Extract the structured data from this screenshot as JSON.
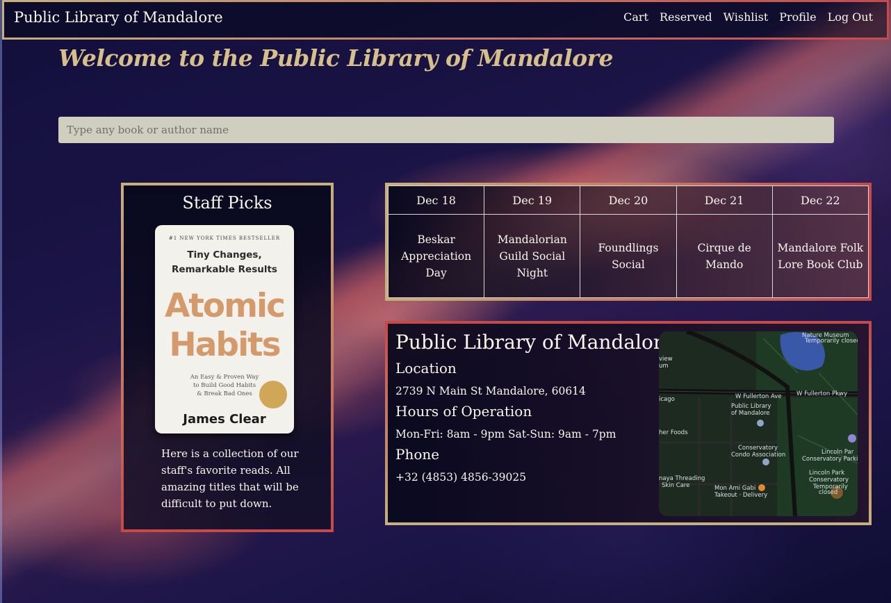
{
  "navbar": {
    "brand": "Public Library of Mandalore",
    "links": [
      "Cart",
      "Reserved",
      "Wishlist",
      "Profile",
      "Log Out"
    ]
  },
  "welcome": "Welcome to the Public Library of Mandalore",
  "search": {
    "placeholder": "Type any book or author name"
  },
  "staff_picks": {
    "title": "Staff Picks",
    "book": {
      "tag": "#1 NEW YORK TIMES BESTSELLER",
      "subtitle_line1": "Tiny Changes,",
      "subtitle_line2": "Remarkable Results",
      "title_line1": "Atomic",
      "title_line2": "Habits",
      "tagline_line1": "An Easy & Proven Way",
      "tagline_line2": "to Build Good Habits",
      "tagline_line3": "& Break Bad Ones",
      "author": "James Clear"
    },
    "description": "Here is a collection of our staff's favorite reads. All amazing titles that will be difficult to put down."
  },
  "events": {
    "dates": [
      "Dec 18",
      "Dec 19",
      "Dec 20",
      "Dec 21",
      "Dec 22"
    ],
    "names": [
      "Beskar Appreciation Day",
      "Mandalorian Guild Social Night",
      "Foundlings Social",
      "Cirque de Mando",
      "Mandalore Folk Lore Book Club"
    ]
  },
  "info": {
    "name": "Public Library of Mandalore",
    "location_heading": "Location",
    "address": "2739 N Main St Mandalore, 60614",
    "hours_heading": "Hours of Operation",
    "hours": "Mon-Fri: 8am - 9pm Sat-Sun: 9am - 7pm",
    "phone_heading": "Phone",
    "phone": "+32 (4853) 4856-39025"
  },
  "map": {
    "labels": {
      "museum": "Nature Museum",
      "museum_status": "Temporarily closed",
      "w_fullerton_ave": "W Fullerton Ave",
      "w_fullerton_pkwy": "W Fullerton Pkwy",
      "library_line1": "Public Library",
      "library_line2": "of Mandalore",
      "conservatory_line1": "Conservatory",
      "conservatory_line2": "Condo Association",
      "lincoln_parking_line1": "Lincoln Par",
      "lincoln_parking_line2": "Conservatory Parking",
      "lincoln_cons_line1": "Lincoln Park",
      "lincoln_cons_line2": "Conservatory",
      "lincoln_cons_line3": "Temporarily",
      "lincoln_cons_line4": "closed",
      "threading_line1": "naya Threading",
      "threading_line2": "Skin Care",
      "mon_ami_line1": "Mon Ami Gabi",
      "mon_ami_line2": "Takeout · Delivery",
      "chicago": "icago",
      "foods": "her Foods",
      "view": "view",
      "view2": "um"
    }
  },
  "colors": {
    "gold": "#c7b07d",
    "red": "#c54a4a",
    "welcome": "#d6bf8a",
    "search_bg": "#d0cfbf"
  }
}
